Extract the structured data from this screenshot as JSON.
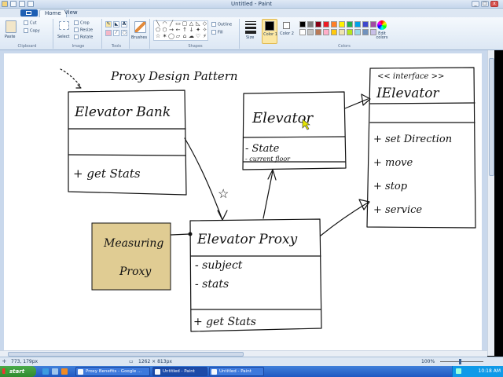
{
  "window": {
    "title": "Untitled - Paint"
  },
  "ribbon": {
    "tabs": [
      "Home",
      "View"
    ],
    "clipboard": {
      "paste": "Paste",
      "cut": "Cut",
      "copy": "Copy",
      "label": "Clipboard"
    },
    "image": {
      "select": "Select",
      "crop": "Crop",
      "resize": "Resize",
      "rotate": "Rotate",
      "label": "Image"
    },
    "tools": {
      "label": "Tools"
    },
    "brushes": {
      "label": "Brushes"
    },
    "shapes": {
      "outline": "Outline",
      "fill": "Fill",
      "label": "Shapes"
    },
    "size": {
      "label": "Size"
    },
    "color1": {
      "label": "Color 1"
    },
    "color2": {
      "label": "Color 2"
    },
    "colors": {
      "label": "Colors",
      "edit": "Edit colors"
    }
  },
  "palette": [
    "#000000",
    "#7f7f7f",
    "#880015",
    "#ed1c24",
    "#ff7f27",
    "#fff200",
    "#22b14c",
    "#00a2e8",
    "#3f48cc",
    "#a349a4",
    "#ffffff",
    "#c3c3c3",
    "#b97a57",
    "#ffaec9",
    "#ffc90e",
    "#efe4b0",
    "#b5e61d",
    "#99d9ea",
    "#7092be",
    "#c8bfe7"
  ],
  "drawing": {
    "title": "Proxy Design Pattern",
    "elevator_bank": {
      "name": "Elevator Bank",
      "op": "+ get Stats"
    },
    "elevator": {
      "name": "Elevator",
      "attr1": "- State",
      "attr2": "- current floor"
    },
    "ielevator": {
      "stereotype": "<< interface >>",
      "name": "IElevator",
      "ops": [
        "+ set Direction",
        "+ move",
        "+ stop",
        "+ service"
      ]
    },
    "measuring_proxy": {
      "line1": "Measuring",
      "line2": "Proxy",
      "fill": "#e0cc93"
    },
    "elevator_proxy": {
      "name": "Elevator Proxy",
      "attr1": "- subject",
      "attr2": "- stats",
      "op": "+ get Stats"
    },
    "star": "☆"
  },
  "status": {
    "cursor": "773, 179px",
    "image_size": "1262 × 813px",
    "zoom": "100%"
  },
  "taskbar": {
    "start": "start",
    "tasks": [
      "Proxy Benefits - Google ...",
      "Untitled - Paint",
      "Untitled - Paint"
    ],
    "clock": "10:18 AM"
  }
}
